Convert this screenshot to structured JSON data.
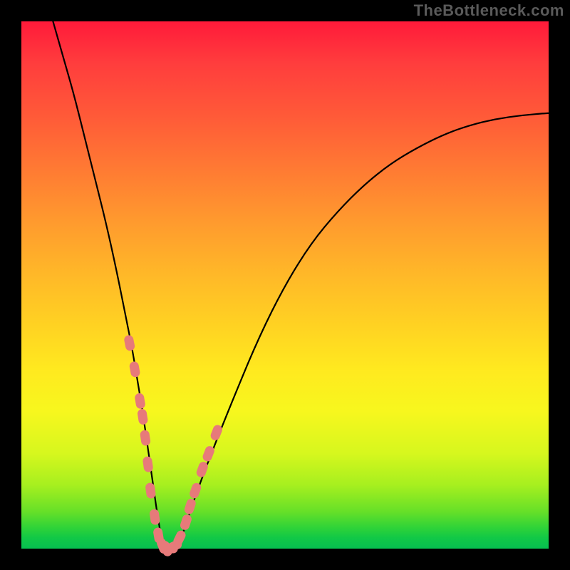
{
  "watermark": "TheBottleneck.com",
  "colors": {
    "frame": "#000000",
    "curve": "#000000",
    "marker": "#e77a7a"
  },
  "chart_data": {
    "type": "line",
    "title": "",
    "xlabel": "",
    "ylabel": "",
    "xlim": [
      0,
      100
    ],
    "ylim": [
      0,
      100
    ],
    "grid": false,
    "legend": false,
    "note": "Values are percentages; x is normalized horizontal position inside plot, y is normalized height from bottom (0=bottom, 100=top). Curve traces a V-shaped bottleneck profile. Markers highlight points along the curve near the trough.",
    "series": [
      {
        "name": "bottleneck-curve",
        "x": [
          6,
          8,
          10,
          12,
          14,
          16,
          18,
          20,
          21,
          22,
          23,
          24,
          25,
          26,
          27,
          28,
          29,
          30,
          31,
          33,
          36,
          40,
          45,
          50,
          55,
          60,
          65,
          70,
          75,
          80,
          85,
          90,
          95,
          100
        ],
        "y": [
          100,
          93,
          86,
          78,
          70,
          62,
          53,
          43,
          38,
          32,
          26,
          19,
          12,
          5,
          0,
          0,
          0,
          1,
          4,
          10,
          18,
          28,
          40,
          50,
          58,
          64,
          69,
          73,
          76,
          78.5,
          80.3,
          81.5,
          82.2,
          82.6
        ]
      },
      {
        "name": "markers",
        "x": [
          20.5,
          21.5,
          22.5,
          23,
          23.5,
          24,
          24.5,
          25.3,
          26,
          26.8,
          27.5,
          28.2,
          29,
          30,
          31.2,
          32,
          33,
          34.3,
          35.5,
          37
        ],
        "y": [
          39,
          34,
          28,
          25,
          21,
          16,
          11,
          6,
          2.5,
          0.5,
          0,
          0,
          0.5,
          2,
          5,
          8,
          11,
          15,
          18,
          22
        ]
      }
    ]
  }
}
